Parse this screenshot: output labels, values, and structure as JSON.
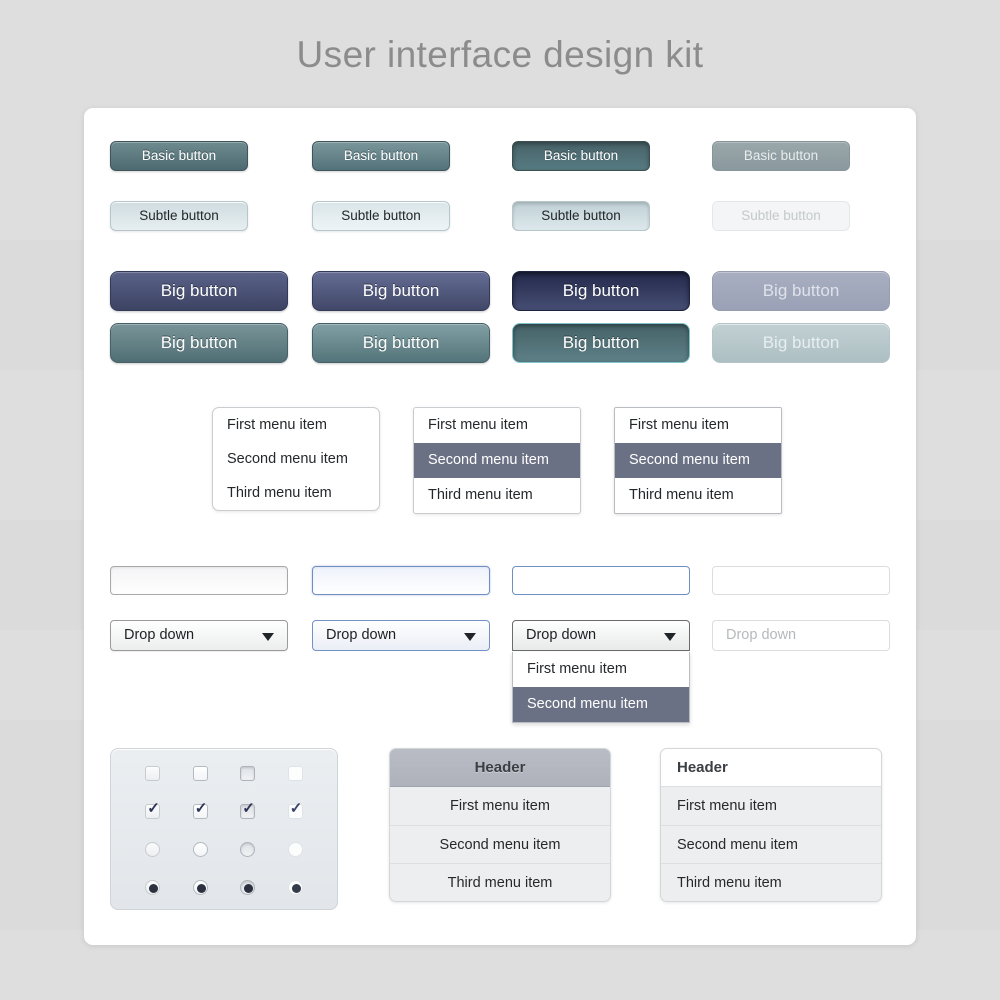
{
  "page": {
    "title": "User interface design kit",
    "background_color": "#dedede",
    "card_color": "#ffffff"
  },
  "colors": {
    "basic_button": "#5c7a80",
    "subtle_button": "#d9e4e8",
    "big_navy": "#4b5375",
    "big_teal": "#63858a",
    "menu_selected": "#6b7185",
    "panel_header": "#b3b7bf",
    "focus_border": "#6f8fc4",
    "title_text": "#8c8c8c"
  },
  "buttons": {
    "basic_label": "Basic button",
    "subtle_label": "Subtle button",
    "big_label": "Big button",
    "states": [
      "normal",
      "hover",
      "pressed",
      "disabled"
    ]
  },
  "menus": {
    "items": [
      "First menu item",
      "Second menu item",
      "Third menu item"
    ],
    "selected_index": 1
  },
  "inputs": {
    "placeholder": "",
    "values": [
      "",
      "",
      "",
      ""
    ],
    "states": [
      "normal",
      "focus",
      "active",
      "disabled"
    ]
  },
  "dropdowns": {
    "label": "Drop down",
    "arrow_icon": "triangle-down-icon",
    "states": [
      "normal",
      "focus",
      "open",
      "disabled"
    ],
    "open_items": [
      "First menu item",
      "Second menu item"
    ],
    "open_selected_index": 1
  },
  "controls": {
    "checkbox_icon": "checkbox-icon",
    "check_icon": "check-mark-icon",
    "radio_icon": "radio-button-icon",
    "states": [
      "normal",
      "hover",
      "pressed",
      "disabled"
    ],
    "rows": [
      {
        "type": "checkbox",
        "checked": false
      },
      {
        "type": "checkbox",
        "checked": true
      },
      {
        "type": "radio",
        "checked": false
      },
      {
        "type": "radio",
        "checked": true
      }
    ]
  },
  "panels": {
    "header_label": "Header",
    "items": [
      "First menu item",
      "Second menu item",
      "Third menu item"
    ]
  }
}
